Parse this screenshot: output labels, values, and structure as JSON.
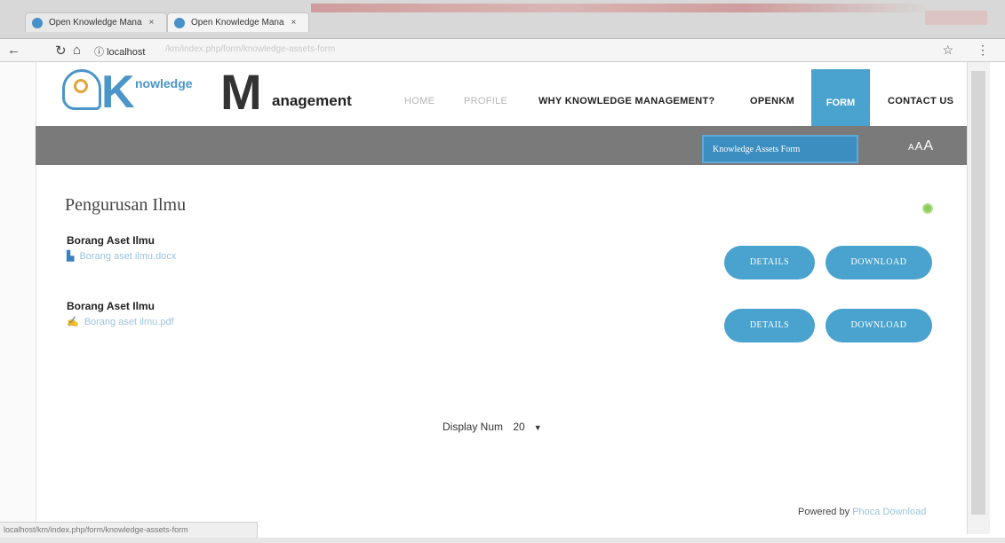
{
  "browser": {
    "tabs": [
      {
        "label": "Open Knowledge Mana"
      },
      {
        "label": "Open Knowledge Mana"
      }
    ],
    "url": "localhost",
    "url_rest": "/km/index.php/form/knowledge-assets-form",
    "status_url": "localhost/km/index.php/form/knowledge-assets-form"
  },
  "logo": {
    "k": "K",
    "k_word": "nowledge",
    "m": "M",
    "m_word": "anagement"
  },
  "nav": {
    "items": [
      "HOME",
      "PROFILE",
      "WHY KNOWLEDGE MANAGEMENT?",
      "OPENKM",
      "FORM",
      "CONTACT US"
    ],
    "active": "FORM",
    "dropdown_item": "Knowledge Assets Form"
  },
  "font_resize": {
    "small": "A",
    "medium": "A",
    "large": "A"
  },
  "main": {
    "title": "Pengurusan Ilmu",
    "files": [
      {
        "title": "Borang Aset Ilmu",
        "file": "Borang aset ilmu.docx",
        "details_label": "DETAILS",
        "download_label": "DOWNLOAD"
      },
      {
        "title": "Borang Aset Ilmu",
        "file": "Borang aset ilmu.pdf",
        "details_label": "DETAILS",
        "download_label": "DOWNLOAD"
      }
    ],
    "display_num_label": "Display Num",
    "display_num_value": "20"
  },
  "footer": {
    "powered_by": "Powered by",
    "powered_link": "Phoca Download"
  },
  "colors": {
    "accent": "#4aa3cf",
    "banner": "#7a7a7a",
    "link": "#9cc4dd"
  }
}
